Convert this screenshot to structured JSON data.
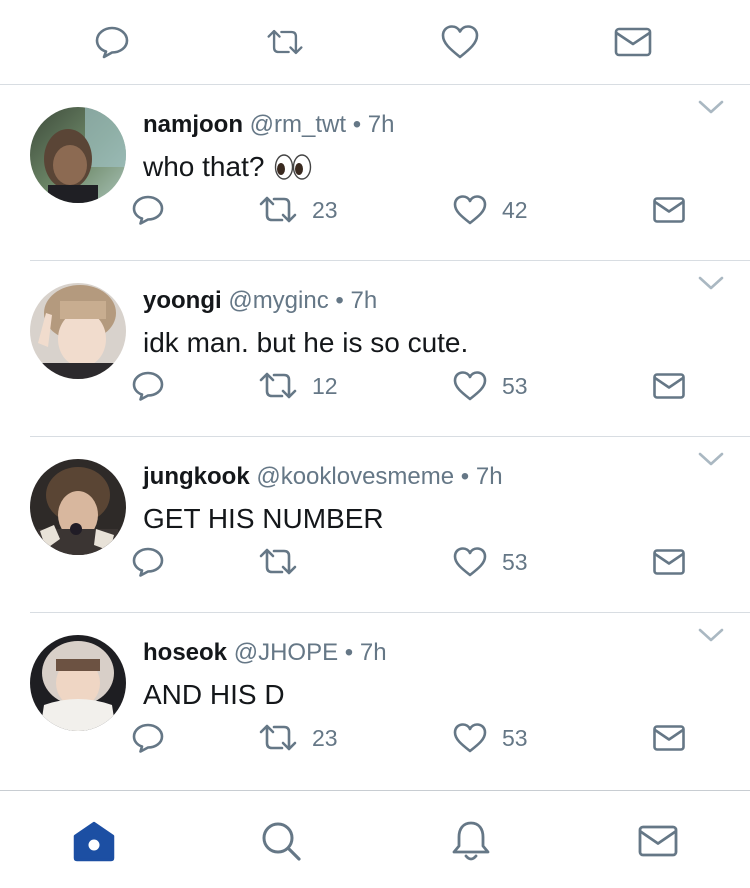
{
  "colors": {
    "text_primary": "#14171a",
    "text_secondary": "#657786",
    "divider": "#d8dde2",
    "nav_active": "#1c4fa3"
  },
  "top_actions": [
    "reply-icon",
    "retweet-icon",
    "like-icon",
    "direct-message-icon"
  ],
  "tweets": [
    {
      "name": "namjoon",
      "handle": "@rm_twt",
      "dot": "•",
      "time": "7h",
      "text": "who that?",
      "emoji": "eyes",
      "retweets": "23",
      "likes": "42"
    },
    {
      "name": "yoongi",
      "handle": "@myginc",
      "dot": "•",
      "time": "7h",
      "text": "idk man. but he is so cute.",
      "retweets": "12",
      "likes": "53"
    },
    {
      "name": "jungkook",
      "handle": "@kooklovesmeme",
      "dot": "•",
      "time": "7h",
      "text": "GET HIS NUMBER",
      "retweets": "",
      "likes": "53"
    },
    {
      "name": "hoseok",
      "handle": "@JHOPE",
      "dot": "•",
      "time": "7h",
      "text": "AND HIS D",
      "retweets": "23",
      "likes": "53"
    }
  ],
  "bottom_nav": [
    "home-icon",
    "search-icon",
    "notifications-icon",
    "messages-icon"
  ],
  "bottom_nav_active": "home-icon"
}
